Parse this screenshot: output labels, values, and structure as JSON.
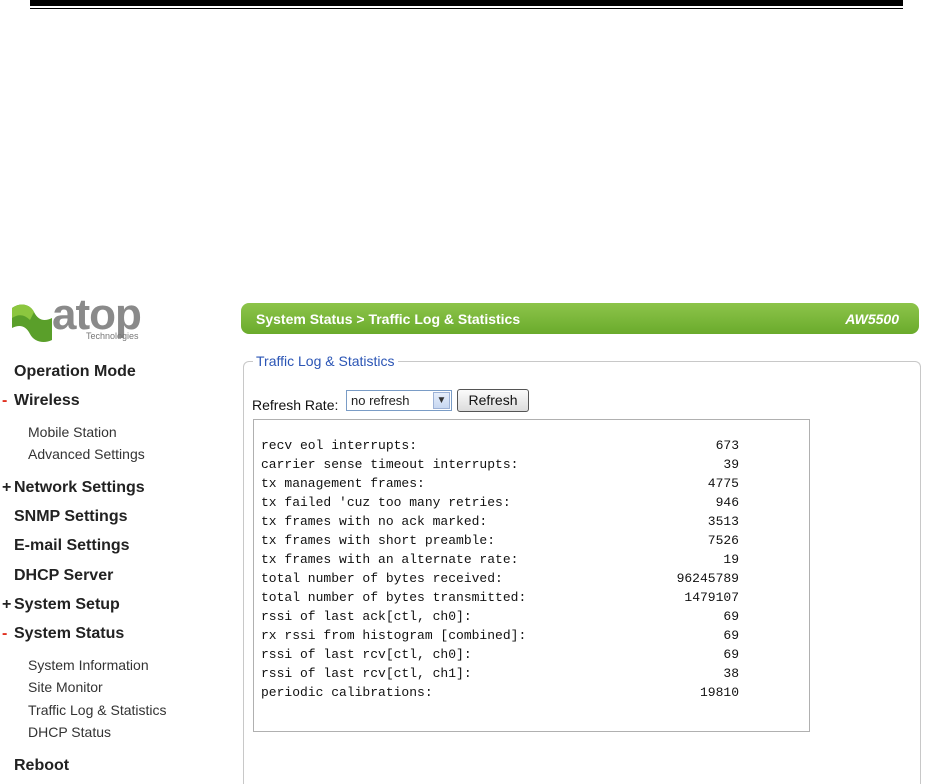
{
  "logo": {
    "text": "atop",
    "sub": "Technologies"
  },
  "sidebar": [
    {
      "label": "Operation Mode",
      "type": "main",
      "mark": ""
    },
    {
      "label": "Wireless",
      "type": "main",
      "mark": "-"
    },
    {
      "label": "Mobile Station",
      "type": "sub",
      "mark": ""
    },
    {
      "label": "Advanced Settings",
      "type": "sub",
      "mark": ""
    },
    {
      "label": "Network Settings",
      "type": "main",
      "mark": "+"
    },
    {
      "label": "SNMP Settings",
      "type": "main",
      "mark": ""
    },
    {
      "label": "E-mail Settings",
      "type": "main",
      "mark": ""
    },
    {
      "label": "DHCP Server",
      "type": "main",
      "mark": ""
    },
    {
      "label": "System Setup",
      "type": "main",
      "mark": "+"
    },
    {
      "label": "System Status",
      "type": "main",
      "mark": "-"
    },
    {
      "label": "System Information",
      "type": "sub",
      "mark": ""
    },
    {
      "label": "Site Monitor",
      "type": "sub",
      "mark": ""
    },
    {
      "label": "Traffic Log & Statistics",
      "type": "sub",
      "mark": ""
    },
    {
      "label": "DHCP Status",
      "type": "sub",
      "mark": ""
    },
    {
      "label": "Reboot",
      "type": "main",
      "mark": ""
    }
  ],
  "header": {
    "title": "System Status > Traffic Log & Statistics",
    "model": "AW5500"
  },
  "panel": {
    "legend": "Traffic Log & Statistics",
    "refresh_label": "Refresh Rate:",
    "refresh_value": "no refresh",
    "refresh_button": "Refresh"
  },
  "stats": [
    {
      "label": "recv eol interrupts:",
      "value": "673"
    },
    {
      "label": "carrier sense timeout interrupts:",
      "value": "39"
    },
    {
      "label": "tx management frames:",
      "value": "4775"
    },
    {
      "label": "tx failed 'cuz too many retries:",
      "value": "946"
    },
    {
      "label": "tx frames with no ack marked:",
      "value": "3513"
    },
    {
      "label": "tx frames with short preamble:",
      "value": "7526"
    },
    {
      "label": "tx frames with an alternate rate:",
      "value": "19"
    },
    {
      "label": "total number of bytes received:",
      "value": "96245789"
    },
    {
      "label": "total number of bytes transmitted:",
      "value": "1479107"
    },
    {
      "label": "rssi of last ack[ctl, ch0]:",
      "value": "69"
    },
    {
      "label": "rx rssi from histogram [combined]:",
      "value": "69"
    },
    {
      "label": "rssi of last rcv[ctl, ch0]:",
      "value": "69"
    },
    {
      "label": "rssi of last rcv[ctl, ch1]:",
      "value": "38"
    },
    {
      "label": "periodic calibrations:",
      "value": "19810"
    }
  ]
}
